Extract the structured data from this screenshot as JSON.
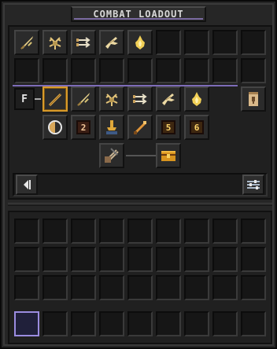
{
  "window": {
    "title": "COMBAT LOADOUT"
  },
  "colors": {
    "accent_purple": "#7d6cb8",
    "gold": "#e2b03a",
    "selected_border": "#d89a2a"
  },
  "loadout_rows": {
    "row1_icons": [
      "dagger-icon",
      "antler-icon",
      "arrows-icon",
      "wing-icon",
      "flame-icon",
      "",
      "",
      "",
      ""
    ],
    "row2_icons": [
      "",
      "",
      "",
      "",
      "",
      "",
      "",
      "",
      ""
    ],
    "row3": {
      "mode_key": "F",
      "icons": [
        "staff-icon",
        "dagger-icon",
        "antler-icon",
        "arrows-icon",
        "wing-icon",
        "flame-icon"
      ],
      "side_icon": "scroll-icon"
    },
    "row4": {
      "items": [
        {
          "icon": "shield-icon",
          "label": ""
        },
        {
          "icon": "badge",
          "label": "2"
        },
        {
          "icon": "anvil-icon",
          "label": ""
        },
        {
          "icon": "sword-icon",
          "label": ""
        },
        {
          "icon": "badge",
          "label": "5"
        },
        {
          "icon": "badge",
          "label": "6"
        }
      ]
    },
    "row5": {
      "left_icon": "quiver-icon",
      "right_icon": "chest-icon"
    }
  },
  "controls": {
    "prev_icon": "prev-page-icon",
    "settings_icon": "sliders-icon"
  },
  "storage": {
    "rows": 3,
    "cols": 9
  },
  "hotbar": {
    "slots": 9,
    "selected_index": 0
  }
}
